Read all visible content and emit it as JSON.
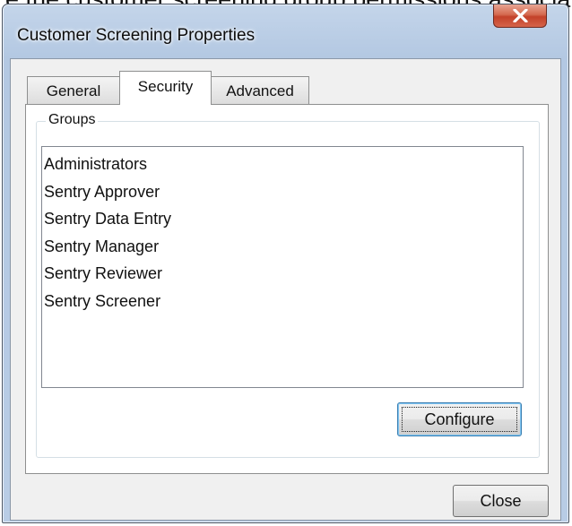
{
  "window": {
    "title": "Customer Screening Properties",
    "close_glyph": "x-icon",
    "top_cutoff_text": "e the customer screening group permissions associated"
  },
  "tabs": [
    {
      "label": "General",
      "active": false
    },
    {
      "label": "Security",
      "active": true
    },
    {
      "label": "Advanced",
      "active": false
    }
  ],
  "groups": {
    "label": "Groups",
    "items": [
      "Administrators",
      "Sentry Approver",
      "Sentry Data Entry",
      "Sentry Manager",
      "Sentry Reviewer",
      "Sentry Screener"
    ]
  },
  "buttons": {
    "configure": "Configure",
    "close": "Close"
  },
  "colors": {
    "frame": "#b8cce5",
    "client": "#f0f0f0",
    "close_red": "#c3422a",
    "focus_blue": "#3c7fb1"
  }
}
